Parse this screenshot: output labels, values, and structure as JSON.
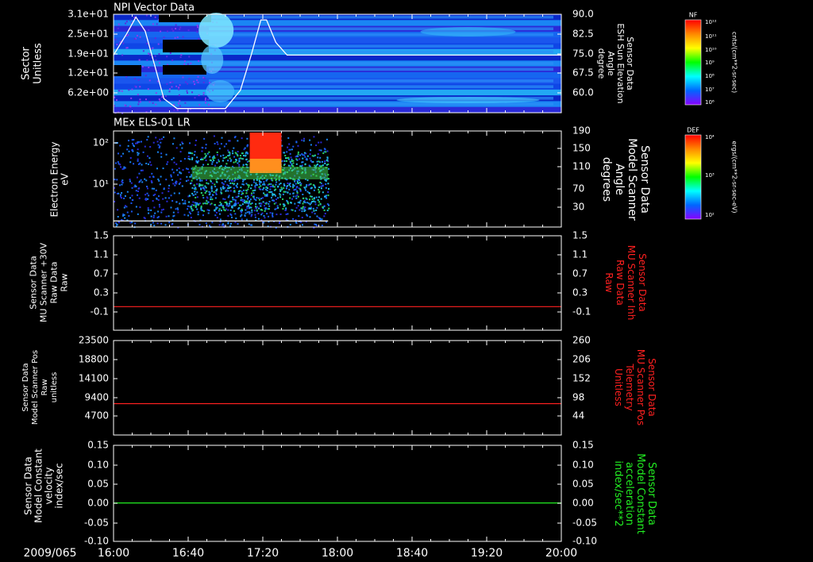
{
  "date_label": "2009/065",
  "time_ticks": [
    "16:00",
    "16:40",
    "17:20",
    "18:00",
    "18:40",
    "19:20",
    "20:00"
  ],
  "colors": {
    "axis": "#ffffff",
    "red": "#ff2020",
    "green": "#22ee22",
    "background": "#000000"
  },
  "chart_data": [
    {
      "type": "heatmap",
      "title": "NPI Vector Data",
      "ylabel": "Sector\nUnitless",
      "yticks": [
        "3.1e+01",
        "2.5e+01",
        "1.9e+01",
        "1.2e+01",
        "6.2e+00"
      ],
      "y2label": "Sensor Data\nESH Sun Elevation\nAngle\ndegree",
      "y2ticks": [
        "90.0",
        "82.5",
        "75.0",
        "67.5",
        "60.0"
      ],
      "y2lim": [
        55,
        90
      ],
      "overlay_line": {
        "color": "white",
        "x": [
          "16:00",
          "16:07",
          "16:12",
          "16:17",
          "16:22",
          "16:27",
          "16:34",
          "16:46",
          "17:00",
          "17:08",
          "17:14",
          "17:19",
          "17:22",
          "17:27",
          "17:33",
          "20:00"
        ],
        "y": [
          75.5,
          83,
          89,
          84,
          72,
          60,
          56.5,
          56.5,
          56.5,
          63,
          76,
          88,
          88,
          80,
          75.5,
          75.5
        ]
      },
      "colorbar": {
        "label": "NF",
        "units": "cnts/(cm**2-sr-sec)",
        "ticks": [
          "10¹²",
          "10¹¹",
          "10¹⁰",
          "10⁹",
          "10⁸",
          "10⁷",
          "10⁶"
        ],
        "colors": [
          "#ff0000",
          "#ff8800",
          "#ffff00",
          "#00ff00",
          "#00ffff",
          "#0066ff",
          "#8800ff"
        ]
      }
    },
    {
      "type": "heatmap",
      "title": "MEx ELS-01 LR",
      "ylabel": "Electron Energy\neV",
      "yticks": [
        "10²",
        "10¹"
      ],
      "y2label": "Sensor Data\nModel Scanner\nAngle\ndegrees",
      "y2ticks": [
        "190",
        "150",
        "110",
        "70",
        "30"
      ],
      "y2lim": [
        0,
        190
      ],
      "data_end": "17:55",
      "overlay_line": {
        "color": "white",
        "x": [
          "16:00",
          "17:55"
        ],
        "y": [
          12,
          12
        ]
      },
      "colorbar": {
        "label": "DEF",
        "units": "ergs/(cm**2-sr-sec-eV)",
        "ticks": [
          "10⁴",
          "10³",
          "10²"
        ],
        "colors": [
          "#ff0000",
          "#ff8800",
          "#ffff00",
          "#00ff00",
          "#00ffff",
          "#0066ff",
          "#8800ff"
        ]
      }
    },
    {
      "type": "line",
      "ylabel": "Sensor Data\nMU Scanner +30V\nRaw Data\nRaw",
      "yticks": [
        "1.5",
        "1.1",
        "0.7",
        "0.3",
        "-0.1"
      ],
      "ylim": [
        -0.5,
        1.5
      ],
      "y2label": "Sensor Data\nMU Scanner Inh\nRaw Data\nRaw",
      "y2ticks": [
        "1.5",
        "1.1",
        "0.7",
        "0.3",
        "-0.1"
      ],
      "series": [
        {
          "color": "#ff2020",
          "x": [
            "16:00",
            "20:00"
          ],
          "y": [
            0.0,
            0.0
          ]
        }
      ]
    },
    {
      "type": "line",
      "ylabel": "Sensor Data\nModel Scanner Pos\nRaw\nunitless",
      "yticks": [
        "23500",
        "18800",
        "14100",
        "9400",
        "4700"
      ],
      "ylim": [
        0,
        23500
      ],
      "y2label": "Sensor Data\nMU Scanner Pos\nTelemetry\nUnitless",
      "y2ticks": [
        "260",
        "206",
        "152",
        "98",
        "44"
      ],
      "series": [
        {
          "color": "#ff2020",
          "x": [
            "16:00",
            "20:00"
          ],
          "y": [
            7800,
            7800
          ]
        }
      ]
    },
    {
      "type": "line",
      "ylabel": "Sensor Data\nModel Constant\nvelocity\nindex/sec",
      "yticks": [
        "0.15",
        "0.10",
        "0.05",
        "0.00",
        "-0.05",
        "-0.10"
      ],
      "ylim": [
        -0.1,
        0.15
      ],
      "y2label": "Sensor Data\nModel Constant\nacceleration\nindex/sec**2",
      "y2ticks": [
        "0.15",
        "0.10",
        "0.05",
        "0.00",
        "-0.05",
        "-0.10"
      ],
      "series": [
        {
          "color": "#22ee22",
          "x": [
            "16:00",
            "20:00"
          ],
          "y": [
            0.0,
            0.0
          ]
        }
      ]
    }
  ]
}
